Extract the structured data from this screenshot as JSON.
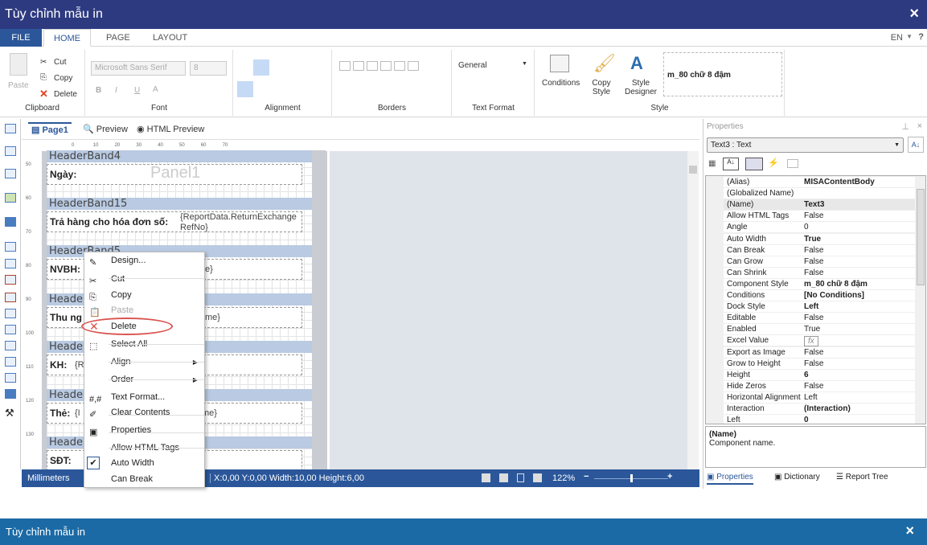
{
  "window": {
    "title": "Tùy chỉnh mẫu in",
    "close_icon": "×"
  },
  "ribbon_tabs": [
    "FILE",
    "HOME",
    "PAGE",
    "LAYOUT"
  ],
  "lang": "EN",
  "help": "?",
  "clipboard": {
    "paste": "Paste",
    "cut": "Cut",
    "copy": "Copy",
    "delete": "Delete",
    "label": "Clipboard"
  },
  "font": {
    "name": "Microsoft Sans Serif",
    "size": "8",
    "label": "Font",
    "bold": "B",
    "italic": "I",
    "underline": "U",
    "color": "A"
  },
  "alignment": {
    "label": "Alignment"
  },
  "borders": {
    "label": "Borders"
  },
  "text_format": {
    "value": "General",
    "label": "Text Format"
  },
  "style": {
    "conditions": "Conditions",
    "copy_style": "Copy Style",
    "style_designer": "Style Designer",
    "current": "m_80 chữ 8 đậm",
    "label": "Style"
  },
  "designer_tabs": [
    "Page1",
    "Preview",
    "HTML Preview"
  ],
  "ruler_h": [
    "0",
    "10",
    "20",
    "30",
    "40",
    "50",
    "60",
    "70"
  ],
  "ruler_v": [
    "50",
    "60",
    "70",
    "80",
    "90",
    "100",
    "110",
    "120",
    "130"
  ],
  "bands": [
    {
      "header": "HeaderBand4",
      "label": "Ngày:",
      "field": "",
      "watermark": "Panel1"
    },
    {
      "header": "HeaderBand15",
      "label": "Trả hàng cho hóa đơn số:",
      "field": "{ReportData.ReturnExchangeRefNo}"
    },
    {
      "header": "HeaderBand5",
      "label": "NVBH:",
      "field": "e}"
    },
    {
      "header": "Heade",
      "label": "Thu ng",
      "field": "me}"
    },
    {
      "header": "Heade",
      "label": "KH:",
      "field": "{R"
    },
    {
      "header": "Heade",
      "label": "Thẻ:",
      "field": "{I",
      "field2": "me}"
    },
    {
      "header": "Heade",
      "label": "SĐT:",
      "field": ""
    }
  ],
  "context_menu": [
    {
      "label": "Design...",
      "icon": "design-icon"
    },
    {
      "label": "Cut",
      "icon": "scissors-icon"
    },
    {
      "label": "Copy",
      "icon": "copy-icon"
    },
    {
      "label": "Paste",
      "icon": "paste-icon",
      "disabled": true
    },
    {
      "label": "Delete",
      "icon": "delete-icon",
      "highlighted": true
    },
    {
      "label": "Select All",
      "icon": "select-all-icon"
    },
    {
      "label": "Align",
      "submenu": true
    },
    {
      "label": "Order",
      "submenu": true
    },
    {
      "label": "Text Format...",
      "icon": "text-format-icon"
    },
    {
      "label": "Clear Contents",
      "icon": "eraser-icon"
    },
    {
      "label": "Properties",
      "icon": "properties-icon"
    },
    {
      "label": "Allow HTML Tags"
    },
    {
      "label": "Auto Width",
      "checked": true
    },
    {
      "label": "Can Break"
    }
  ],
  "statusbar": {
    "units": "Millimeters",
    "coords": "X:0,00  Y:0,00  Width:10,00  Height:6,00",
    "zoom": "122%",
    "zoom_minus": "−",
    "zoom_plus": "+"
  },
  "properties": {
    "title": "Properties",
    "selected": "Text3 : Text",
    "rows": [
      {
        "k": "(Alias)",
        "v": "MISAContentBody",
        "b": true
      },
      {
        "k": "(Globalized Name)",
        "v": ""
      },
      {
        "k": "(Name)",
        "v": "Text3",
        "b": true
      },
      {
        "k": "Allow HTML Tags",
        "v": "False"
      },
      {
        "k": "Angle",
        "v": "0"
      },
      {
        "k": "Auto Width",
        "v": "True",
        "b": true
      },
      {
        "k": "Can Break",
        "v": "False"
      },
      {
        "k": "Can Grow",
        "v": "False"
      },
      {
        "k": "Can Shrink",
        "v": "False"
      },
      {
        "k": "Component Style",
        "v": "m_80 chữ 8 đậm",
        "b": true
      },
      {
        "k": "Conditions",
        "v": "[No Conditions]",
        "b": true
      },
      {
        "k": "Dock Style",
        "v": "Left",
        "b": true
      },
      {
        "k": "Editable",
        "v": "False"
      },
      {
        "k": "Enabled",
        "v": "True"
      },
      {
        "k": "Excel Value",
        "v": "fx"
      },
      {
        "k": "Export as Image",
        "v": "False"
      },
      {
        "k": "Grow to Height",
        "v": "False"
      },
      {
        "k": "Height",
        "v": "6",
        "b": true
      },
      {
        "k": "Hide Zeros",
        "v": "False"
      },
      {
        "k": "Horizontal Alignment",
        "v": "Left"
      },
      {
        "k": "Interaction",
        "v": "(Interaction)",
        "b": true
      },
      {
        "k": "Left",
        "v": "0",
        "b": true
      }
    ],
    "desc_title": "(Name)",
    "desc": "Component name.",
    "tabs": [
      "Properties",
      "Dictionary",
      "Report Tree"
    ]
  },
  "bottom": {
    "title": "Tùy chỉnh mẫu in",
    "close_icon": "×"
  },
  "colors": {
    "title": "#2d3a80",
    "accent": "#2b579a",
    "bottom": "#1c6aa5",
    "band": "#b9cae2",
    "delete_highlight": "#d9534f"
  }
}
